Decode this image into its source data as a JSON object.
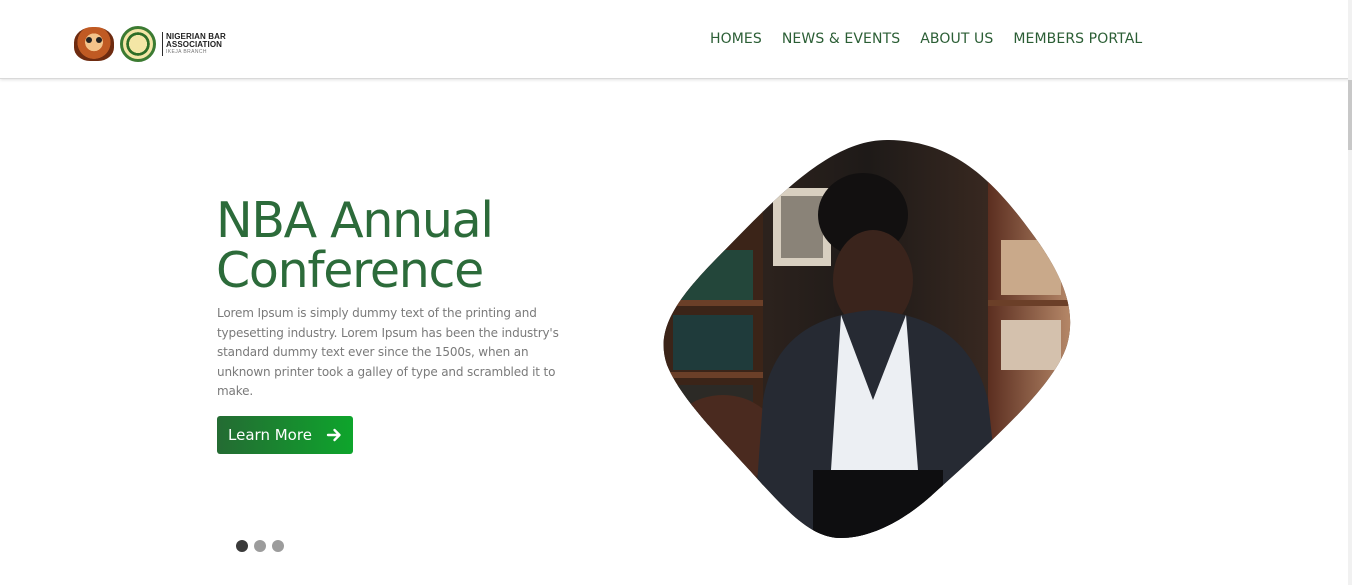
{
  "brand": {
    "line1": "NIGERIAN BAR",
    "line2": "ASSOCIATION",
    "line3": "IKEJA BRANCH"
  },
  "nav": {
    "items": [
      {
        "label": "HOMES"
      },
      {
        "label": "NEWS & EVENTS"
      },
      {
        "label": "ABOUT US"
      },
      {
        "label": "MEMBERS PORTAL"
      }
    ]
  },
  "hero": {
    "title_line1": "NBA Annual",
    "title_line2": "Conference",
    "description": "Lorem Ipsum is simply dummy text of the printing and typesetting industry. Lorem Ipsum has been the industry's standard dummy text ever since the 1500s, when an unknown printer took a galley of type and scrambled it to make.",
    "button_label": "Learn More",
    "button_icon": "arrow-right-icon"
  },
  "slider": {
    "total": 3,
    "active": 1
  },
  "colors": {
    "brand_green": "#2c6b3a",
    "nav_green": "#2b5e35",
    "button_start": "#246b33",
    "button_end": "#0ea52c"
  }
}
